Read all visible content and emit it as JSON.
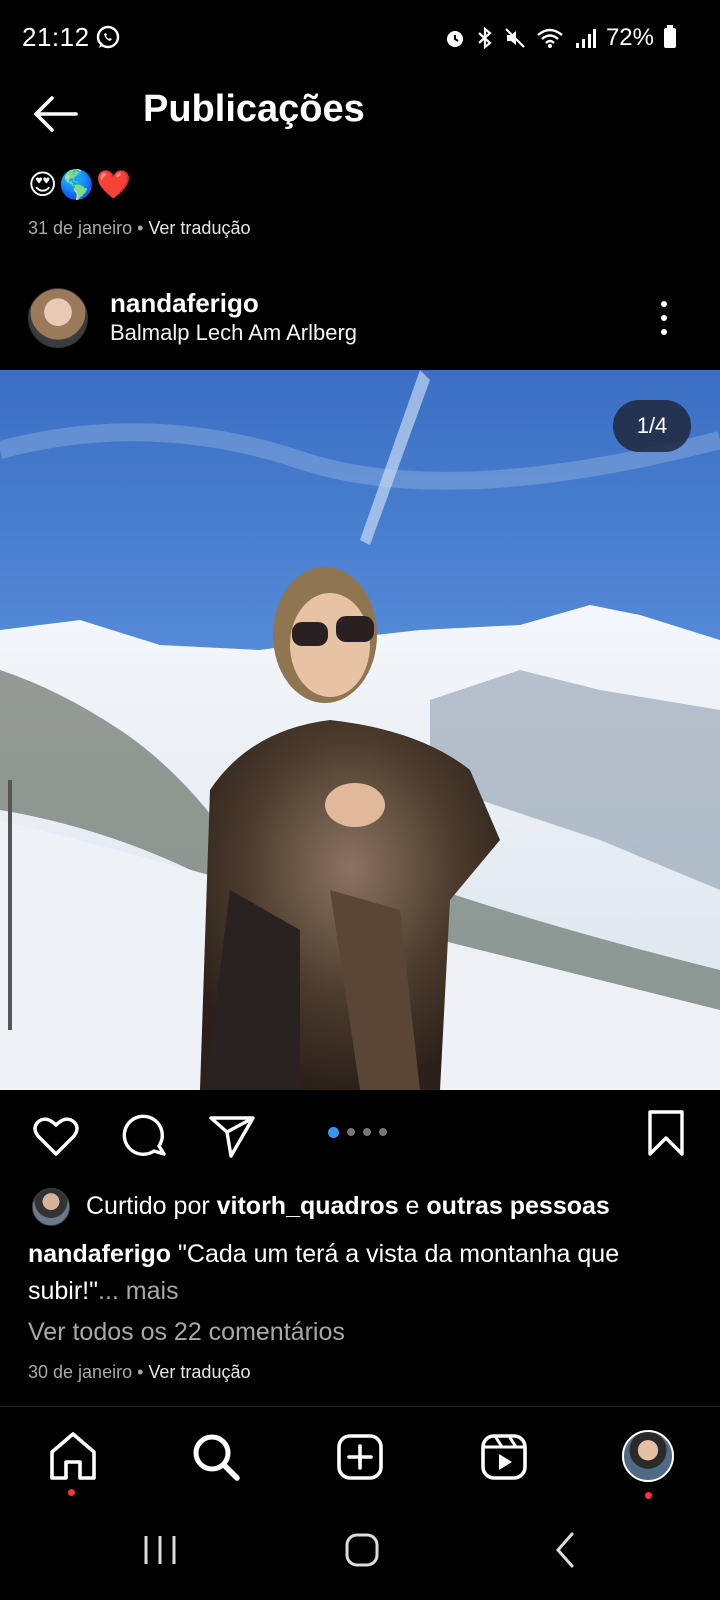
{
  "status_bar": {
    "time": "21:12",
    "battery": "72%",
    "icons": [
      "whatsapp-icon",
      "alarm-icon",
      "bluetooth-icon",
      "mute-icon",
      "wifi-icon",
      "signal-icon",
      "battery-icon"
    ]
  },
  "header": {
    "title": "Publicações"
  },
  "previous_post": {
    "caption_emojis": "😍🌎❤️",
    "date": "31 de janeiro",
    "separator": " • ",
    "translate": "Ver tradução"
  },
  "post": {
    "author": "nandaferigo",
    "location": "Balmalp Lech Am Arlberg",
    "image_counter": "1/4",
    "carousel": {
      "total": 4,
      "active": 1
    },
    "likes": {
      "prefix": "Curtido por ",
      "user": "vitorh_quadros",
      "connector": " e ",
      "others": "outras pessoas"
    },
    "caption": {
      "author": "nandaferigo",
      "text": " \"Cada um terá a vista da montanha que subir!\"",
      "ellipsis": "...",
      "more": " mais"
    },
    "comments_link": "Ver todos os 22 comentários",
    "date": "30 de janeiro",
    "separator": " • ",
    "translate": "Ver tradução"
  },
  "colors": {
    "background": "#000000",
    "accent": "#3797f0",
    "notification": "#ff3040",
    "muted_text": "#a8a8a8"
  }
}
